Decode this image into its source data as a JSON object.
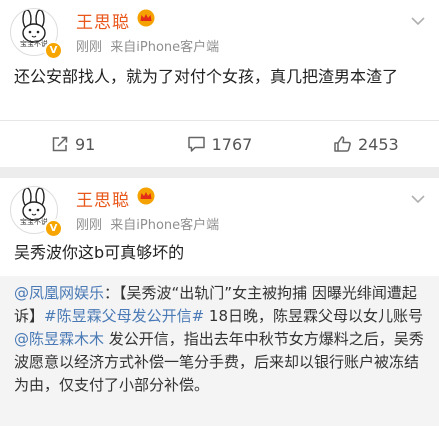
{
  "posts": [
    {
      "author": "王思聪",
      "avatar_caption": "宝宝不说",
      "time": "刚刚",
      "source": "来自iPhone客户端",
      "text": "还公安部找人，就为了对付个女孩，真几把渣男本渣了",
      "actions": {
        "repost_icon": "share-box-icon",
        "repost_count": "91",
        "comment_icon": "comment-icon",
        "comment_count": "1767",
        "like_icon": "thumbs-up-icon",
        "like_count": "2453"
      }
    },
    {
      "author": "王思聪",
      "avatar_caption": "宝宝不说",
      "time": "刚刚",
      "source": "来自iPhone客户端",
      "text": "吴秀波你这b可真够坏的",
      "repost": {
        "mention": "@凤凰网娱乐",
        "colon": "：",
        "body1": "【吴秀波“出轨门”女主被拘捕 因曝光绯闻遭起诉】",
        "hashtag": "#陈昱霖父母发公开信#",
        "body2": " 18日晚，陈昱霖父母以女儿账号",
        "mention2": "@陈昱霖木木",
        "body3": " 发公开信，指出去年中秋节女方爆料之后，吴秀波愿意以经济方式补偿一笔分手费，后来却以银行账户被冻结为由，仅支付了小部分补偿。"
      }
    }
  ],
  "colors": {
    "name": "#e8561a",
    "link": "#4a7ab5",
    "meta": "#8f8f8f",
    "badge": "#f7a500"
  }
}
